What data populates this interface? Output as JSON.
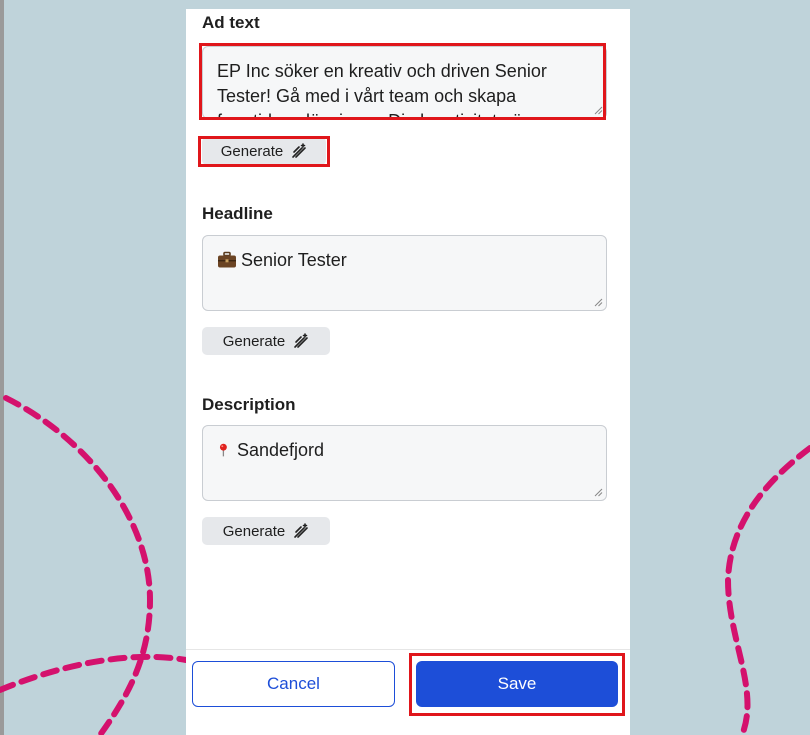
{
  "ad_text": {
    "label": "Ad text",
    "value": "EP Inc söker en kreativ och driven Senior Tester! Gå med i vårt team och skapa framtidens lösningar. Din kreativitet gör skillnad.",
    "generate_label": "Generate"
  },
  "headline": {
    "label": "Headline",
    "value": "Senior Tester",
    "icon": "briefcase-icon",
    "generate_label": "Generate"
  },
  "description": {
    "label": "Description",
    "value": "Sandefjord",
    "icon": "pin-icon",
    "generate_label": "Generate"
  },
  "footer": {
    "cancel_label": "Cancel",
    "save_label": "Save"
  },
  "colors": {
    "background": "#bfd3da",
    "primary": "#1d4ed8",
    "highlight": "#e0161b",
    "decoration": "#d4116d"
  }
}
